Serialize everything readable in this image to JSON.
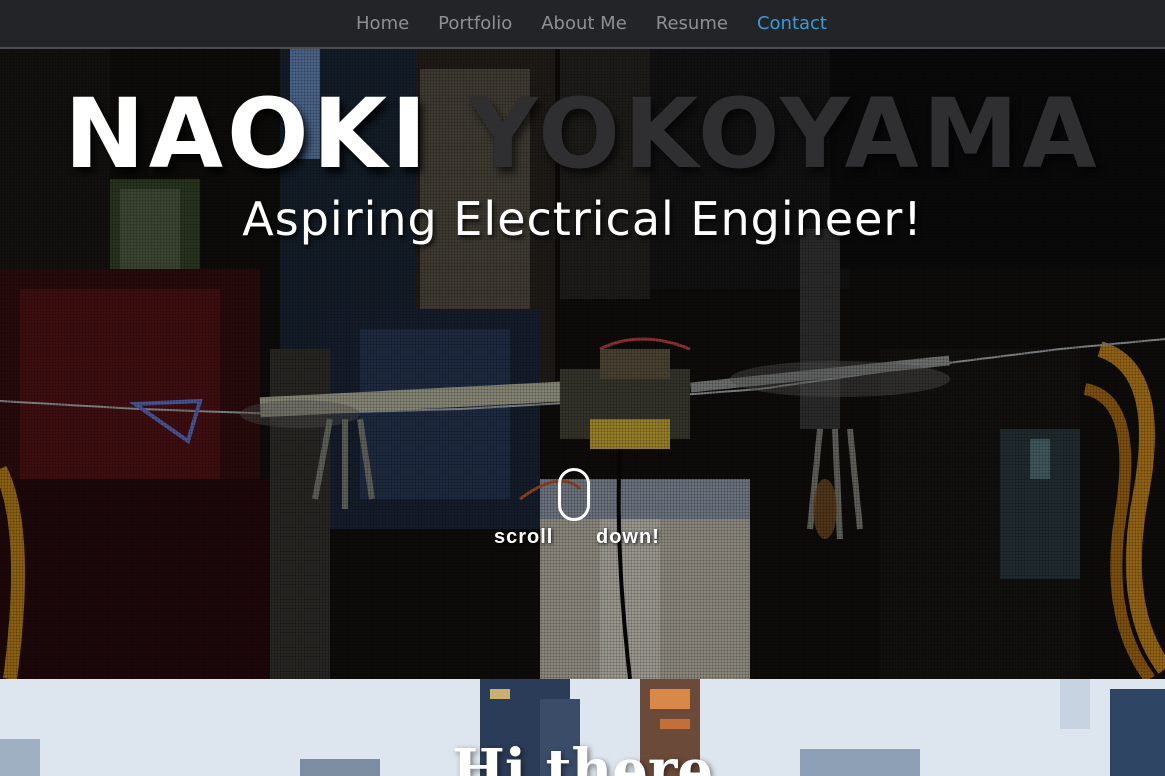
{
  "nav": {
    "items": [
      {
        "label": "Home"
      },
      {
        "label": "Portfolio"
      },
      {
        "label": "About Me"
      },
      {
        "label": "Resume"
      },
      {
        "label": "Contact"
      }
    ],
    "active_color": "#3a9bd3",
    "inactive_color": "#8e8f94"
  },
  "hero": {
    "first_name": "NAOKI",
    "last_name": "YOKOYAMA",
    "subtitle": "Aspiring Electrical Engineer!",
    "scroll_left": "scroll",
    "scroll_right": "down!"
  },
  "section_two": {
    "heading": "Hi there"
  }
}
